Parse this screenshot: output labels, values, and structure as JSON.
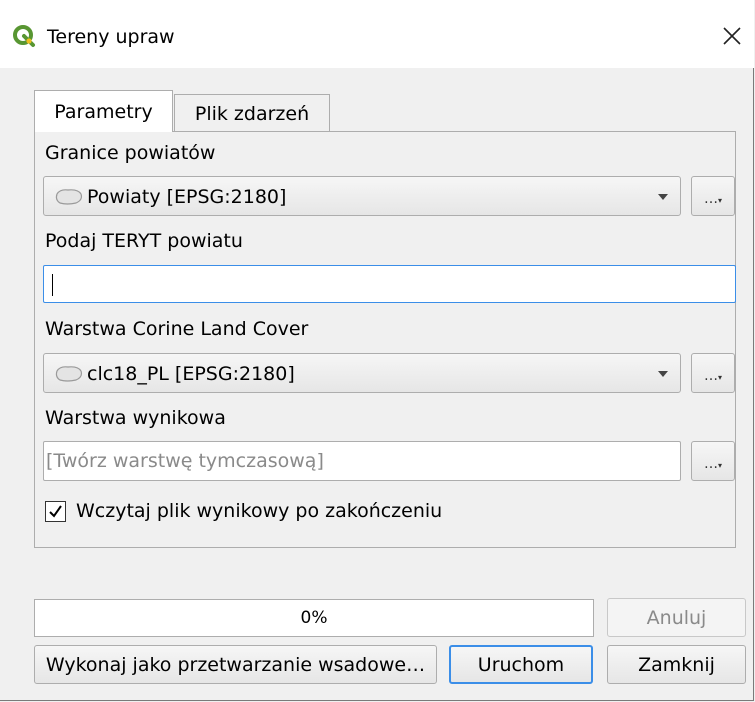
{
  "window": {
    "title": "Tereny upraw",
    "app_icon": "qgis-logo-icon",
    "close_icon": "close-icon"
  },
  "tabs": [
    {
      "label": "Parametry",
      "active": true
    },
    {
      "label": "Plik zdarzeń",
      "active": false
    }
  ],
  "params": {
    "county_boundaries": {
      "label": "Granice powiatów",
      "value": "Powiaty [EPSG:2180]",
      "icon": "polygon-layer-icon",
      "browse_label": "…"
    },
    "teryt": {
      "label": "Podaj TERYT powiatu",
      "value": ""
    },
    "corine": {
      "label": "Warstwa Corine Land Cover",
      "value": "clc18_PL [EPSG:2180]",
      "icon": "polygon-layer-icon",
      "browse_label": "…"
    },
    "output": {
      "label": "Warstwa wynikowa",
      "placeholder": "[Twórz warstwę tymczasową]",
      "browse_label": "…"
    },
    "load_result": {
      "label": "Wczytaj plik wynikowy po zakończeniu",
      "checked": true
    }
  },
  "footer": {
    "progress_text": "0%",
    "progress": 0,
    "cancel_label": "Anuluj",
    "batch_label": "Wykonaj jako przetwarzanie wsadowe…",
    "run_label": "Uruchom",
    "close_label": "Zamknij"
  },
  "colors": {
    "focus": "#3b8ee8",
    "qgis_green": "#589632",
    "qgis_yellow": "#eebe1f"
  }
}
